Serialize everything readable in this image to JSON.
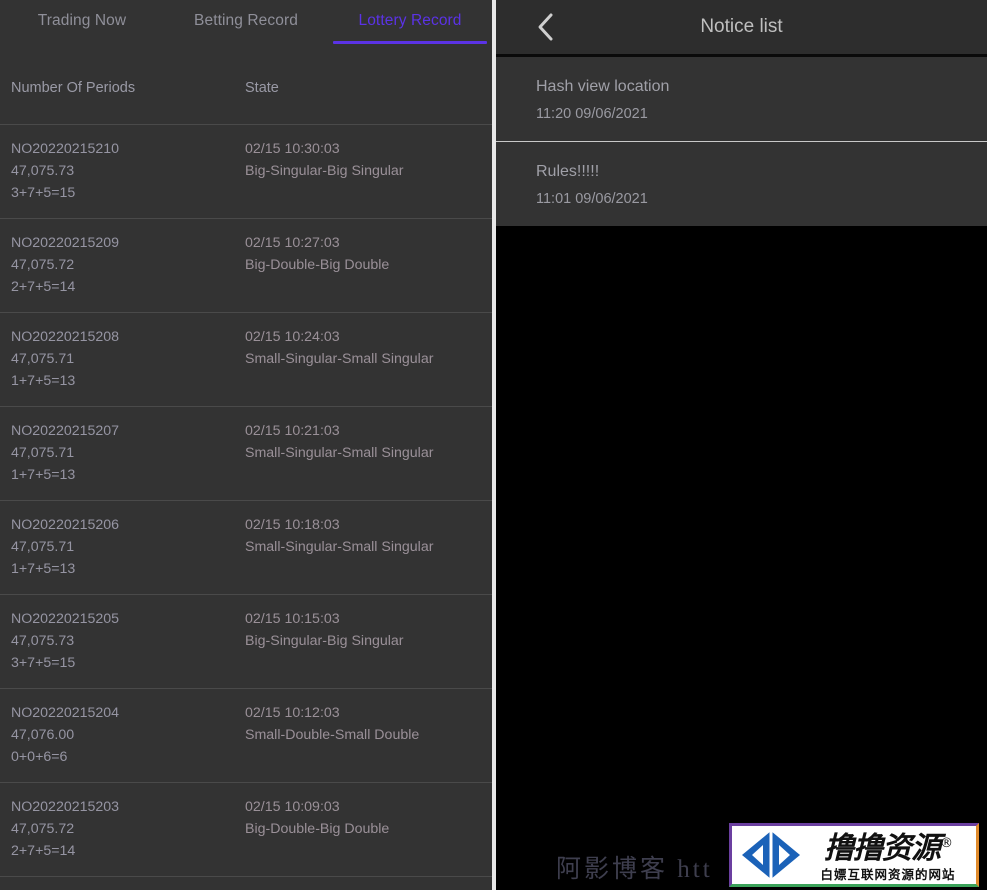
{
  "left_panel": {
    "tabs": [
      {
        "label": "Trading Now",
        "active": false
      },
      {
        "label": "Betting Record",
        "active": false
      },
      {
        "label": "Lottery Record",
        "active": true
      }
    ],
    "accent_color": "#5b33e6",
    "columns": {
      "col1": "Number Of Periods",
      "col2": "State"
    },
    "rows": [
      {
        "period": "NO20220215210",
        "amount": "47,075.73",
        "sum": "3+7+5=15",
        "time": "02/15 10:30:03",
        "state": "Big-Singular-Big Singular"
      },
      {
        "period": "NO20220215209",
        "amount": "47,075.72",
        "sum": "2+7+5=14",
        "time": "02/15 10:27:03",
        "state": "Big-Double-Big Double"
      },
      {
        "period": "NO20220215208",
        "amount": "47,075.71",
        "sum": "1+7+5=13",
        "time": "02/15 10:24:03",
        "state": "Small-Singular-Small Singular"
      },
      {
        "period": "NO20220215207",
        "amount": "47,075.71",
        "sum": "1+7+5=13",
        "time": "02/15 10:21:03",
        "state": "Small-Singular-Small Singular"
      },
      {
        "period": "NO20220215206",
        "amount": "47,075.71",
        "sum": "1+7+5=13",
        "time": "02/15 10:18:03",
        "state": "Small-Singular-Small Singular"
      },
      {
        "period": "NO20220215205",
        "amount": "47,075.73",
        "sum": "3+7+5=15",
        "time": "02/15 10:15:03",
        "state": "Big-Singular-Big Singular"
      },
      {
        "period": "NO20220215204",
        "amount": "47,076.00",
        "sum": "0+0+6=6",
        "time": "02/15 10:12:03",
        "state": "Small-Double-Small Double"
      },
      {
        "period": "NO20220215203",
        "amount": "47,075.72",
        "sum": "2+7+5=14",
        "time": "02/15 10:09:03",
        "state": "Big-Double-Big Double"
      }
    ]
  },
  "right_panel": {
    "header": {
      "back_icon": "chevron-left-icon",
      "title": "Notice list"
    },
    "notices": [
      {
        "title": "Hash view location",
        "time": "11:20 09/06/2021"
      },
      {
        "title": "Rules!!!!!",
        "time": "11:01 09/06/2021"
      }
    ]
  },
  "watermarks": {
    "blog_text": "阿影博客 htt",
    "logo_main": "撸撸资源",
    "logo_registered": "®",
    "logo_sub": "白嫖互联网资源的网站"
  }
}
